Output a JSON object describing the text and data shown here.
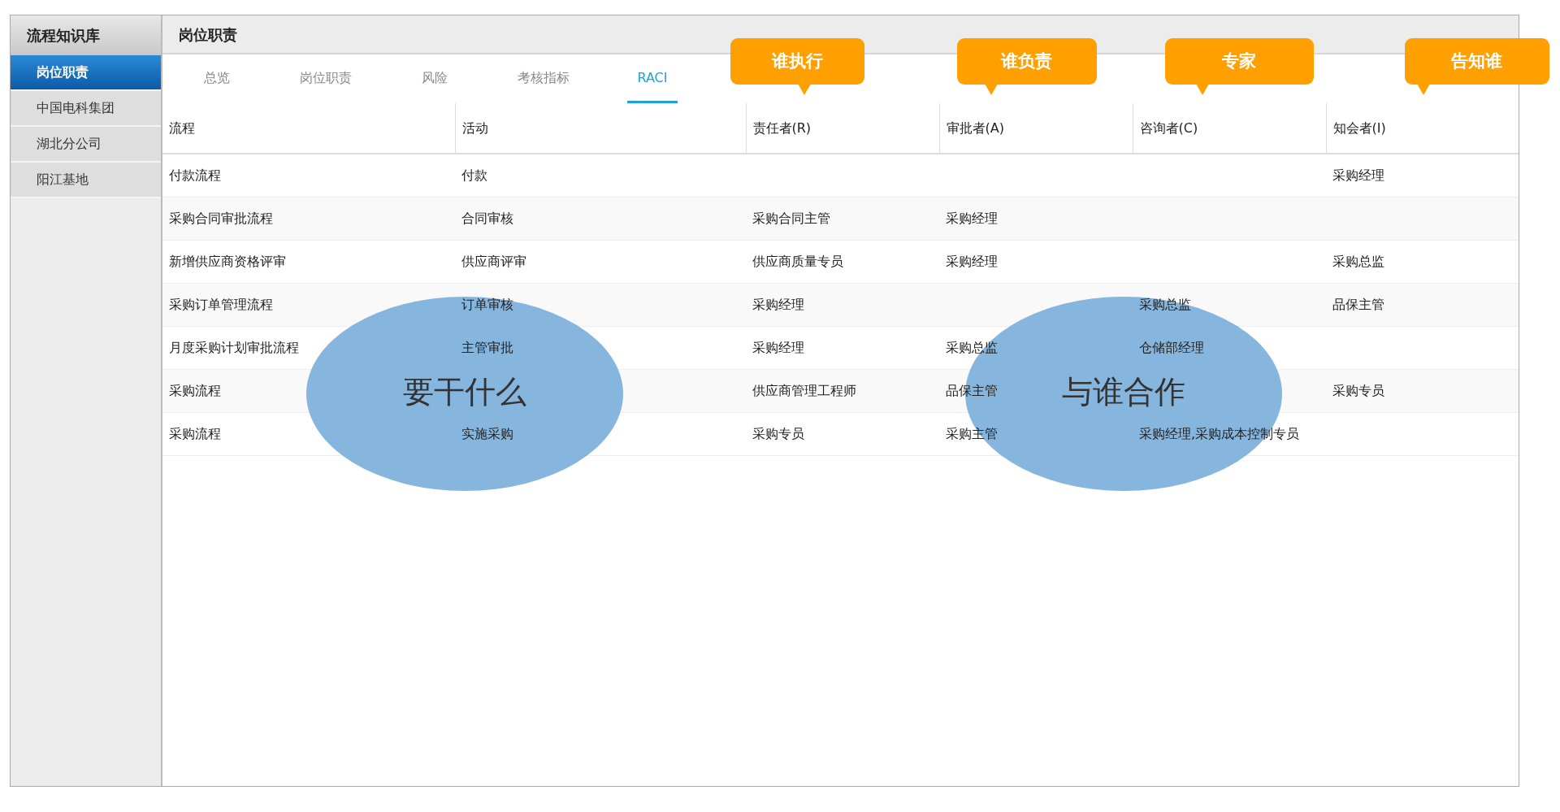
{
  "sidebar": {
    "title": "流程知识库",
    "items": [
      {
        "label": "岗位职责",
        "selected": true
      },
      {
        "label": "中国电科集团",
        "selected": false
      },
      {
        "label": "湖北分公司",
        "selected": false
      },
      {
        "label": "阳江基地",
        "selected": false
      }
    ]
  },
  "header": {
    "title": "岗位职责"
  },
  "tabs": [
    {
      "label": "总览",
      "selected": false
    },
    {
      "label": "岗位职责",
      "selected": false
    },
    {
      "label": "风险",
      "selected": false
    },
    {
      "label": "考核指标",
      "selected": false
    },
    {
      "label": "RACI",
      "selected": true
    }
  ],
  "table": {
    "columns": [
      "流程",
      "活动",
      "责任者(R)",
      "审批者(A)",
      "咨询者(C)",
      "知会者(I)"
    ],
    "rows": [
      {
        "process": "付款流程",
        "activity": "付款",
        "informed": "采购经理"
      },
      {
        "process": "采购合同审批流程",
        "activity": "合同审核",
        "responsible": "采购合同主管",
        "accountable": "采购经理"
      },
      {
        "process": "新增供应商资格评审",
        "activity": "供应商评审",
        "responsible": "供应商质量专员",
        "accountable": "采购经理",
        "informed": "采购总监"
      },
      {
        "process": "采购订单管理流程",
        "activity": "订单审核",
        "responsible": "采购经理",
        "consulted": "采购总监",
        "informed": "品保主管"
      },
      {
        "process": "月度采购计划审批流程",
        "activity": "主管审批",
        "responsible": "采购经理",
        "accountable": "采购总监",
        "consulted": "仓储部经理"
      },
      {
        "process": "采购流程",
        "responsible": "供应商管理工程师",
        "accountable": "品保主管",
        "informed": "采购专员"
      },
      {
        "process": "采购流程",
        "activity": "实施采购",
        "responsible": "采购专员",
        "accountable": "采购主管",
        "consulted": "采购经理,采购成本控制专员"
      }
    ]
  },
  "callouts": [
    {
      "text": "谁执行"
    },
    {
      "text": "谁负责"
    },
    {
      "text": "专家"
    },
    {
      "text": "告知谁"
    }
  ],
  "ellipses": [
    {
      "text": "要干什么"
    },
    {
      "text": "与谁合作"
    }
  ]
}
